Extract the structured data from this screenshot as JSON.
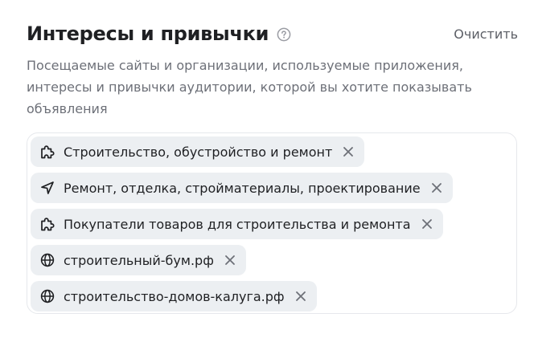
{
  "section": {
    "title": "Интересы и привычки",
    "help_icon": "question-circle-icon",
    "clear_label": "Очистить",
    "description": "Посещаемые сайты и организации, используемые приложения, интересы и привычки аудитории, которой вы хотите показывать объявления"
  },
  "tags": [
    {
      "label": "Строительство, обустройство и ремонт",
      "icon": "puzzle-icon"
    },
    {
      "label": "Ремонт, отделка, стройматериалы, проектирование",
      "icon": "navigation-arrow-icon"
    },
    {
      "label": "Покупатели товаров для строительства и ремонта",
      "icon": "puzzle-icon"
    },
    {
      "label": "строительный-бум.рф",
      "icon": "globe-icon"
    },
    {
      "label": "строительство-домов-калуга.рф",
      "icon": "globe-icon"
    }
  ],
  "colors": {
    "title": "#1f2023",
    "muted": "#6d7078",
    "tag_bg": "#eceff2",
    "border": "#e6e8ec",
    "icon": "#9a9ca3"
  }
}
